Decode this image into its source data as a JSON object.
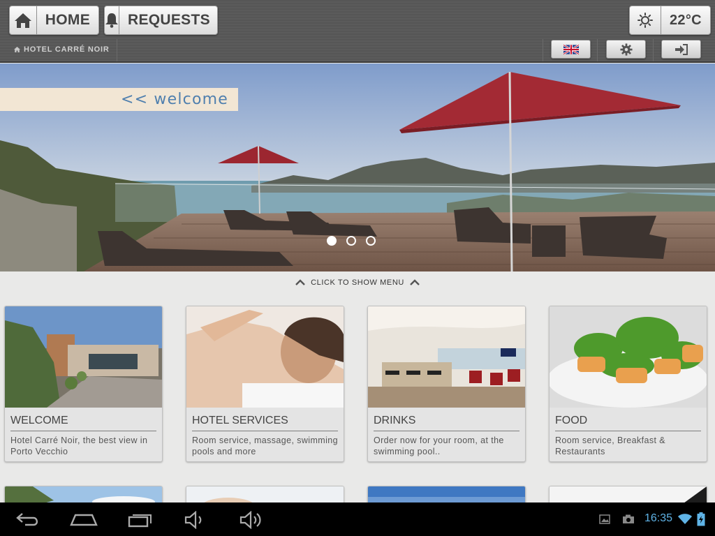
{
  "header": {
    "home_label": "HOME",
    "requests_label": "REQUESTS",
    "temperature": "22°C",
    "hotel_name": "HOTEL CARRÉ NOIR"
  },
  "hero": {
    "banner_text": "<< welcome",
    "slides_count": 3,
    "active_slide": 1
  },
  "menu_toggle": {
    "label": "CLICK TO SHOW MENU"
  },
  "cards": [
    {
      "title": "WELCOME",
      "description": "Hotel Carré Noir, the best view in Porto Vecchio"
    },
    {
      "title": "HOTEL SERVICES",
      "description": "Room service, massage, swimming pools and more"
    },
    {
      "title": "DRINKS",
      "description": "Order now for your room, at the swimming pool.."
    },
    {
      "title": "FOOD",
      "description": "Room service, Breakfast & Restaurants"
    }
  ],
  "statusbar": {
    "time": "16:35"
  },
  "icons": {
    "home": "home-icon",
    "requests": "bell-icon",
    "weather": "sun-icon",
    "language": "uk-flag-icon",
    "settings": "gear-icon",
    "login": "login-icon"
  },
  "colors": {
    "banner_bg": "#f2e6d4",
    "banner_text": "#4f7fae",
    "clock": "#5fb3e6"
  }
}
